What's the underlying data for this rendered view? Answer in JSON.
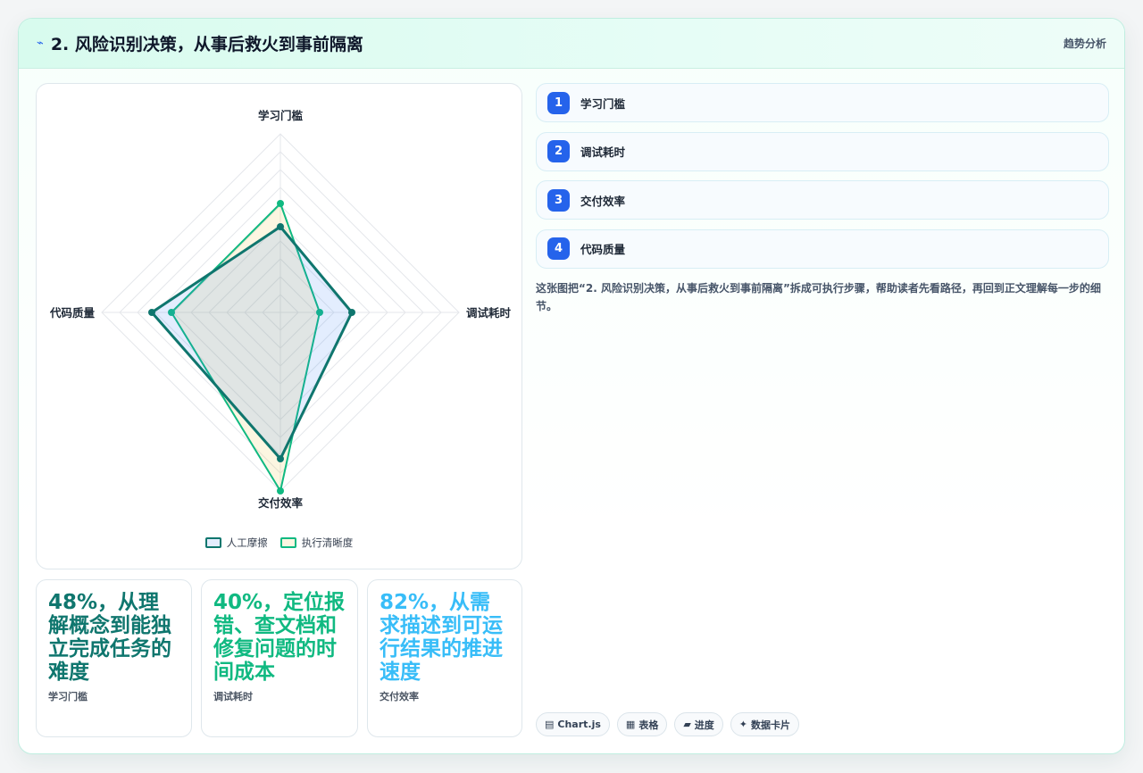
{
  "header": {
    "icon": "pulse-icon",
    "title": "2. 风险识别决策，从事后救火到事前隔离",
    "tag": "趋势分析"
  },
  "chart_data": {
    "type": "radar",
    "axes": [
      "学习门槛",
      "调试耗时",
      "交付效率",
      "代码质量"
    ],
    "range": [
      0,
      100
    ],
    "grid": true,
    "legend_position": "bottom",
    "series": [
      {
        "name": "人工摩擦",
        "values": [
          48,
          40,
          82,
          72
        ],
        "color": "#0f766e",
        "fill": "rgba(59,130,246,0.14)"
      },
      {
        "name": "执行清晰度",
        "values": [
          61,
          22,
          100,
          61
        ],
        "color": "#10b981",
        "fill": "rgba(234,179,8,0.12)"
      }
    ]
  },
  "stats": [
    {
      "big": "48%，从理解概念到能独立完成任务的难度",
      "sub": "学习门槛",
      "color": "#0f766e"
    },
    {
      "big": "40%，定位报错、查文档和修复问题的时间成本",
      "sub": "调试耗时",
      "color": "#10b981"
    },
    {
      "big": "82%，从需求描述到可运行结果的推进速度",
      "sub": "交付效率",
      "color": "#38bdf8"
    }
  ],
  "steps": [
    {
      "num": "1",
      "label": "学习门槛"
    },
    {
      "num": "2",
      "label": "调试耗时"
    },
    {
      "num": "3",
      "label": "交付效率"
    },
    {
      "num": "4",
      "label": "代码质量"
    }
  ],
  "description": "这张图把“2. 风险识别决策，从事后救火到事前隔离”拆成可执行步骤，帮助读者先看路径，再回到正文理解每一步的细节。",
  "chips": [
    {
      "icon": "chart-icon",
      "glyph": "▤",
      "label": "Chart.js"
    },
    {
      "icon": "table-icon",
      "glyph": "▦",
      "label": "表格"
    },
    {
      "icon": "progress-icon",
      "glyph": "▰",
      "label": "进度"
    },
    {
      "icon": "sparkle-icon",
      "glyph": "✦",
      "label": "数据卡片"
    }
  ]
}
